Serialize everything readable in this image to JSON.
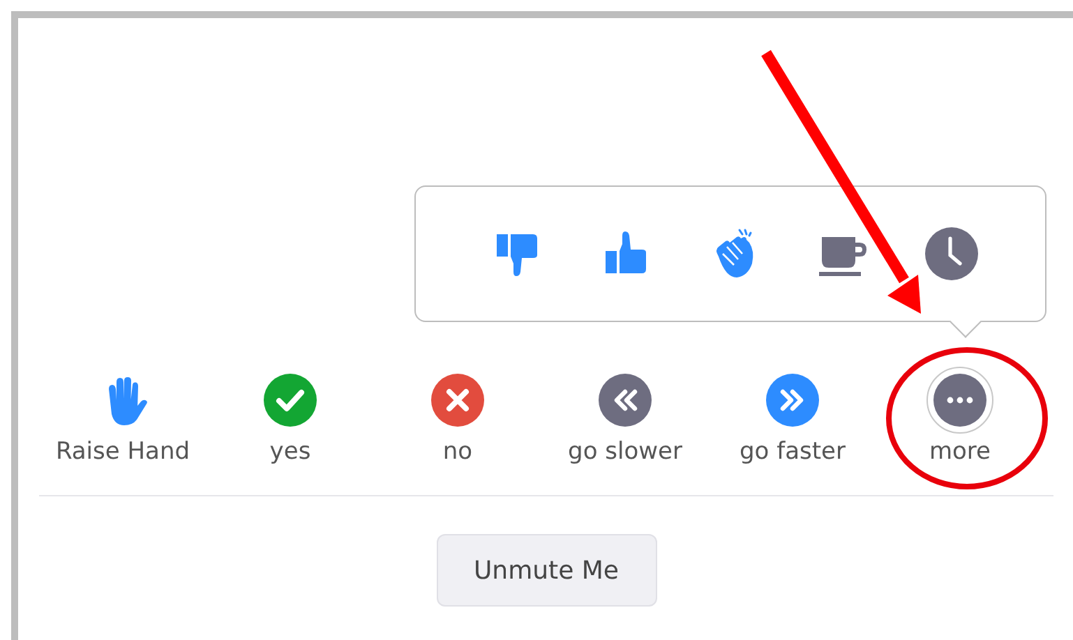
{
  "popover": {
    "open": true,
    "reactions": [
      {
        "kind": "thumbs-down"
      },
      {
        "kind": "thumbs-up"
      },
      {
        "kind": "clap"
      },
      {
        "kind": "coffee"
      },
      {
        "kind": "clock"
      }
    ]
  },
  "reactions": [
    {
      "kind": "raise-hand",
      "label": "Raise Hand",
      "selected": false
    },
    {
      "kind": "yes",
      "label": "yes",
      "selected": false
    },
    {
      "kind": "no",
      "label": "no",
      "selected": false
    },
    {
      "kind": "slower",
      "label": "go slower",
      "selected": false
    },
    {
      "kind": "faster",
      "label": "go faster",
      "selected": false
    },
    {
      "kind": "more",
      "label": "more",
      "selected": true
    }
  ],
  "unmute_button": "Unmute Me",
  "annotations": {
    "arrow": true,
    "circle": true
  }
}
